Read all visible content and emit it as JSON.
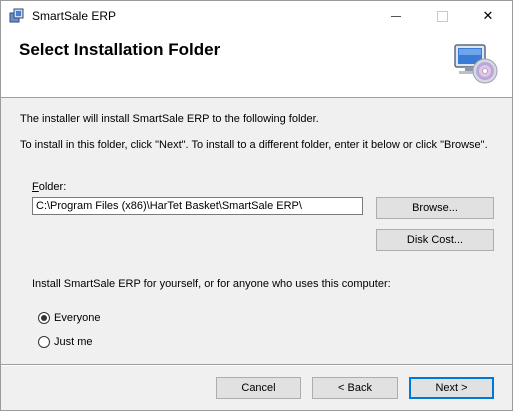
{
  "window": {
    "title": "SmartSale ERP",
    "controls": {
      "minimize": "minimize",
      "maximize": "maximize",
      "close": "✕"
    }
  },
  "banner": {
    "title": "Select Installation Folder",
    "icon": "computer-cd-icon"
  },
  "body": {
    "line1": "The installer will install SmartSale ERP to the following folder.",
    "line2": "To install in this folder, click \"Next\". To install to a different folder, enter it below or click \"Browse\"."
  },
  "folder": {
    "label_accel": "F",
    "label_rest": "older:",
    "value": "C:\\Program Files (x86)\\HarTet Basket\\SmartSale ERP\\"
  },
  "buttons": {
    "browse": "Browse...",
    "disk_cost": "Disk Cost...",
    "cancel": "Cancel",
    "back": "< Back",
    "next": "Next >"
  },
  "install_for": {
    "prompt": "Install SmartSale ERP for yourself, or for anyone who uses this computer:",
    "options": [
      {
        "label": "Everyone",
        "selected": true
      },
      {
        "label": "Just me",
        "selected": false
      }
    ]
  }
}
